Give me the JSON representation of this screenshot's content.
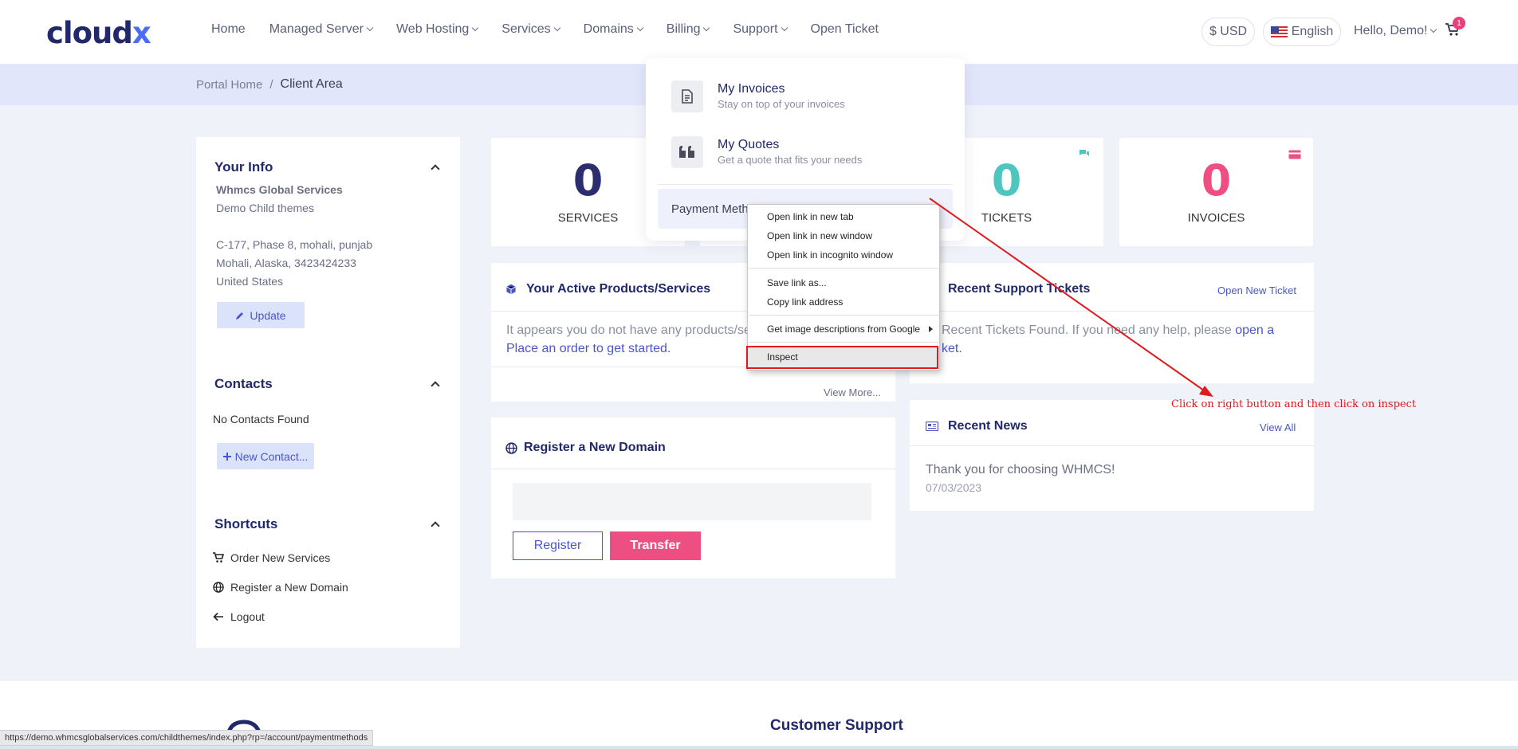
{
  "brand": {
    "logo_text": "cloud",
    "logo_suffix": "x"
  },
  "nav": {
    "items": [
      {
        "label": "Home",
        "dropdown": false
      },
      {
        "label": "Managed Server",
        "dropdown": true
      },
      {
        "label": "Web Hosting",
        "dropdown": true
      },
      {
        "label": "Services",
        "dropdown": true
      },
      {
        "label": "Domains",
        "dropdown": true
      },
      {
        "label": "Billing",
        "dropdown": true
      },
      {
        "label": "Support",
        "dropdown": true
      },
      {
        "label": "Open Ticket",
        "dropdown": false
      }
    ],
    "currency": "$ USD",
    "language": "English",
    "greeting": "Hello, Demo!",
    "cart_count": "1"
  },
  "breadcrumb": {
    "home": "Portal Home",
    "separator": "/",
    "current": "Client Area"
  },
  "sidebar": {
    "your_info": {
      "title": "Your Info",
      "company": "Whmcs Global Services",
      "name": "Demo Child themes",
      "address1": "C-177, Phase 8, mohali, punjab",
      "address2": "Mohali, Alaska, 3423424233",
      "country": "United States",
      "update_label": "Update"
    },
    "contacts": {
      "title": "Contacts",
      "empty": "No Contacts Found",
      "new_label": "New Contact..."
    },
    "shortcuts": {
      "title": "Shortcuts",
      "items": [
        "Order New Services",
        "Register a New Domain",
        "Logout"
      ]
    }
  },
  "stats": {
    "services": {
      "value": "0",
      "label": "SERVICES",
      "color": "#2b2d6e"
    },
    "tickets": {
      "value": "0",
      "label": "TICKETS",
      "color": "#4ec5be"
    },
    "invoices": {
      "value": "0",
      "label": "INVOICES",
      "color": "#ee4f82"
    }
  },
  "products_panel": {
    "title": "Your Active Products/Services",
    "text": "It appears you do not have any products/se",
    "link": "Place an order to get started.",
    "view_more": "View More..."
  },
  "domain_panel": {
    "title": "Register a New Domain",
    "register_label": "Register",
    "transfer_label": "Transfer"
  },
  "tickets_panel": {
    "title": "Recent Support Tickets",
    "action": "Open New Ticket",
    "text": "Recent Tickets Found. If you need any help, please",
    "link_a": "open a",
    "link_b": "ket."
  },
  "news_panel": {
    "title": "Recent News",
    "action": "View All",
    "item_title": "Thank you for choosing WHMCS!",
    "item_date": "07/03/2023"
  },
  "billing_dropdown": {
    "items": [
      {
        "title": "My Invoices",
        "subtitle": "Stay on top of your invoices"
      },
      {
        "title": "My Quotes",
        "subtitle": "Get a quote that fits your needs"
      }
    ],
    "payment_label": "Payment Meth"
  },
  "context_menu": {
    "items": [
      "Open link in new tab",
      "Open link in new window",
      "Open link in incognito window",
      "Save link as...",
      "Copy link address",
      "Get image descriptions from Google",
      "Inspect"
    ]
  },
  "annotation": "Click on right button and then click on inspect",
  "footer": {
    "title": "Customer Support"
  },
  "status_url": "https://demo.whmcsglobalservices.com/childthemes/index.php?rp=/account/paymentmethods",
  "colors": {
    "accent": "#4a56c8",
    "brand": "#22296a",
    "pink": "#ee4f82",
    "teal": "#4ec5be",
    "annotation": "#e0191d"
  }
}
